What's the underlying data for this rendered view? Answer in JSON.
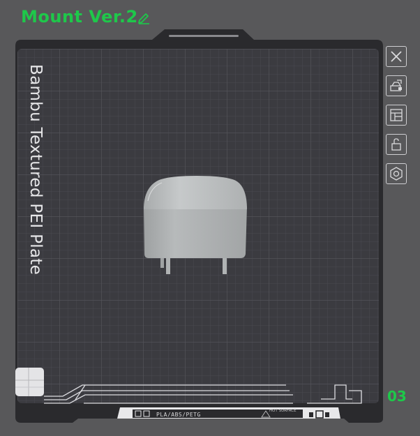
{
  "plate": {
    "title": "Mount Ver.2",
    "bed_label": "Bambu Textured PEI Plate",
    "plate_number": "03",
    "filament_label": "PLA/ABS/PETG",
    "hot_surface_label": "HOT SURFACE"
  },
  "toolbar": {
    "items": [
      {
        "name": "close-icon"
      },
      {
        "name": "auto-orient-icon"
      },
      {
        "name": "arrange-icon"
      },
      {
        "name": "unlock-icon"
      },
      {
        "name": "settings-icon"
      }
    ]
  },
  "colors": {
    "accent": "#1ec84a",
    "bed": "#3b3b40",
    "frame": "#2a2a2d",
    "model": "#bcbfc0"
  }
}
